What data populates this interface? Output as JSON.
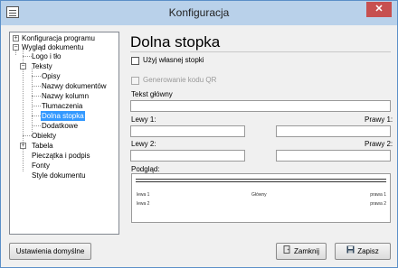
{
  "window": {
    "title": "Konfiguracja"
  },
  "tree": {
    "items": [
      {
        "label": "Konfiguracja programu",
        "expander": "+"
      },
      {
        "label": "Wygląd dokumentu",
        "expander": "−"
      },
      {
        "label": "Logo i tło"
      },
      {
        "label": "Teksty",
        "expander": "−"
      },
      {
        "label": "Opisy"
      },
      {
        "label": "Nazwy dokumentów"
      },
      {
        "label": "Nazwy kolumn"
      },
      {
        "label": "Tłumaczenia"
      },
      {
        "label": "Dolna stopka"
      },
      {
        "label": "Dodatkowe"
      },
      {
        "label": "Obiekty"
      },
      {
        "label": "Tabela",
        "expander": "+"
      },
      {
        "label": "Pieczątka i podpis"
      },
      {
        "label": "Fonty"
      },
      {
        "label": "Style dokumentu"
      }
    ]
  },
  "panel": {
    "title": "Dolna stopka",
    "own_footer_label": "Użyj własnej stopki",
    "qr_label": "Generowanie kodu QR",
    "main_text_label": "Tekst główny",
    "main_text_value": "",
    "left1_label": "Lewy 1:",
    "right1_label": "Prawy 1:",
    "left2_label": "Lewy 2:",
    "right2_label": "Prawy 2:",
    "left1_value": "",
    "right1_value": "",
    "left2_value": "",
    "right2_value": "",
    "preview_label": "Podgląd:",
    "preview": {
      "left1": "lewa 1",
      "main": "Główny",
      "right1": "prawa 1",
      "left2": "lewa 2",
      "right2": "prawa 2"
    }
  },
  "buttons": {
    "defaults": "Ustawienia domyślne",
    "close": "Zamknij",
    "save": "Zapisz"
  },
  "icons": {
    "app": "app-window-icon",
    "close": "close-icon",
    "close_button_icon": "door-exit-icon",
    "save_button_icon": "floppy-disk-icon"
  },
  "colors": {
    "titlebar": "#b9d1ea",
    "close_button": "#c75050",
    "selection": "#3399ff"
  }
}
